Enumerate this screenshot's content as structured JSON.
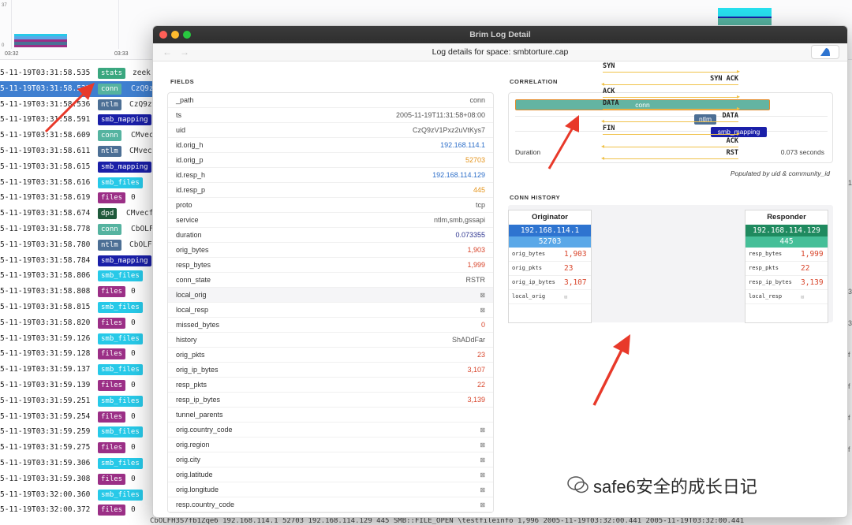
{
  "histogram": {
    "y_top": "37",
    "y_zero": "0",
    "x_labels": [
      "03:32",
      "03:33"
    ]
  },
  "log_rows": [
    {
      "ts": "5-11-19T03:31:58.535",
      "path": "stats",
      "uid": "zeek",
      "selected": false
    },
    {
      "ts": "5-11-19T03:31:58.535",
      "path": "conn",
      "uid": "CzQ9z",
      "selected": true
    },
    {
      "ts": "5-11-19T03:31:58.536",
      "path": "ntlm",
      "uid": "CzQ9z",
      "selected": false
    },
    {
      "ts": "5-11-19T03:31:58.591",
      "path": "smb_mapping",
      "uid": "",
      "selected": false
    },
    {
      "ts": "5-11-19T03:31:58.609",
      "path": "conn",
      "uid": "CMvec",
      "selected": false
    },
    {
      "ts": "5-11-19T03:31:58.611",
      "path": "ntlm",
      "uid": "CMvec",
      "selected": false
    },
    {
      "ts": "5-11-19T03:31:58.615",
      "path": "smb_mapping",
      "uid": "",
      "selected": false
    },
    {
      "ts": "5-11-19T03:31:58.616",
      "path": "smb_files",
      "uid": "",
      "selected": false
    },
    {
      "ts": "5-11-19T03:31:58.619",
      "path": "files",
      "uid": "0",
      "selected": false
    },
    {
      "ts": "5-11-19T03:31:58.674",
      "path": "dpd",
      "uid": "CMvecf",
      "selected": false
    },
    {
      "ts": "5-11-19T03:31:58.778",
      "path": "conn",
      "uid": "CbOLF",
      "selected": false
    },
    {
      "ts": "5-11-19T03:31:58.780",
      "path": "ntlm",
      "uid": "CbOLF",
      "selected": false
    },
    {
      "ts": "5-11-19T03:31:58.784",
      "path": "smb_mapping",
      "uid": "",
      "selected": false
    },
    {
      "ts": "5-11-19T03:31:58.806",
      "path": "smb_files",
      "uid": "",
      "selected": false
    },
    {
      "ts": "5-11-19T03:31:58.808",
      "path": "files",
      "uid": "0",
      "selected": false
    },
    {
      "ts": "5-11-19T03:31:58.815",
      "path": "smb_files",
      "uid": "",
      "selected": false
    },
    {
      "ts": "5-11-19T03:31:58.820",
      "path": "files",
      "uid": "0",
      "selected": false
    },
    {
      "ts": "5-11-19T03:31:59.126",
      "path": "smb_files",
      "uid": "",
      "selected": false
    },
    {
      "ts": "5-11-19T03:31:59.128",
      "path": "files",
      "uid": "0",
      "selected": false
    },
    {
      "ts": "5-11-19T03:31:59.137",
      "path": "smb_files",
      "uid": "",
      "selected": false
    },
    {
      "ts": "5-11-19T03:31:59.139",
      "path": "files",
      "uid": "0",
      "selected": false
    },
    {
      "ts": "5-11-19T03:31:59.251",
      "path": "smb_files",
      "uid": "",
      "selected": false
    },
    {
      "ts": "5-11-19T03:31:59.254",
      "path": "files",
      "uid": "0",
      "selected": false
    },
    {
      "ts": "5-11-19T03:31:59.259",
      "path": "smb_files",
      "uid": "",
      "selected": false
    },
    {
      "ts": "5-11-19T03:31:59.275",
      "path": "files",
      "uid": "0",
      "selected": false
    },
    {
      "ts": "5-11-19T03:31:59.306",
      "path": "smb_files",
      "uid": "",
      "selected": false
    },
    {
      "ts": "5-11-19T03:31:59.308",
      "path": "files",
      "uid": "0",
      "selected": false
    },
    {
      "ts": "5-11-19T03:32:00.360",
      "path": "smb_files",
      "uid": "",
      "selected": false
    },
    {
      "ts": "5-11-19T03:32:00.372",
      "path": "files",
      "uid": "0",
      "selected": false
    }
  ],
  "bottom_row_text": "CbOLFH3S7fb1Zqe6  192.168.114.1  52703  192.168.114.129  445  SMB::FILE_OPEN  \\testfileinfo  1,996  2005-11-19T03:32:00.441  2005-11-19T03:32:00.441",
  "window": {
    "title": "Brim Log Detail",
    "subtitle": "Log details for space: smbtorture.cap",
    "back_icon": "back-arrow-icon",
    "forward_icon": "forward-arrow-icon"
  },
  "fields_header": "FIELDS",
  "fields": [
    {
      "name": "_path",
      "value": "conn",
      "kind": "plain"
    },
    {
      "name": "ts",
      "value": "2005-11-19T11:31:58+08:00",
      "kind": "plain"
    },
    {
      "name": "uid",
      "value": "CzQ9zV1Pxz2uVtKys7",
      "kind": "plain"
    },
    {
      "name": "id.orig_h",
      "value": "192.168.114.1",
      "kind": "blue"
    },
    {
      "name": "id.orig_p",
      "value": "52703",
      "kind": "orange"
    },
    {
      "name": "id.resp_h",
      "value": "192.168.114.129",
      "kind": "blue"
    },
    {
      "name": "id.resp_p",
      "value": "445",
      "kind": "orange"
    },
    {
      "name": "proto",
      "value": "tcp",
      "kind": "plain"
    },
    {
      "name": "service",
      "value": "ntlm,smb,gssapi",
      "kind": "plain"
    },
    {
      "name": "duration",
      "value": "0.073355",
      "kind": "navy"
    },
    {
      "name": "orig_bytes",
      "value": "1,903",
      "kind": "red"
    },
    {
      "name": "resp_bytes",
      "value": "1,999",
      "kind": "red"
    },
    {
      "name": "conn_state",
      "value": "RSTR",
      "kind": "plain"
    },
    {
      "name": "local_orig",
      "value": "⊠",
      "kind": "null",
      "hl": true
    },
    {
      "name": "local_resp",
      "value": "⊠",
      "kind": "null"
    },
    {
      "name": "missed_bytes",
      "value": "0",
      "kind": "red"
    },
    {
      "name": "history",
      "value": "ShADdFar",
      "kind": "plain"
    },
    {
      "name": "orig_pkts",
      "value": "23",
      "kind": "red"
    },
    {
      "name": "orig_ip_bytes",
      "value": "3,107",
      "kind": "red"
    },
    {
      "name": "resp_pkts",
      "value": "22",
      "kind": "red"
    },
    {
      "name": "resp_ip_bytes",
      "value": "3,139",
      "kind": "red"
    },
    {
      "name": "tunnel_parents",
      "value": "",
      "kind": "plain"
    },
    {
      "name": "orig.country_code",
      "value": "⊠",
      "kind": "null"
    },
    {
      "name": "orig.region",
      "value": "⊠",
      "kind": "null"
    },
    {
      "name": "orig.city",
      "value": "⊠",
      "kind": "null"
    },
    {
      "name": "orig.latitude",
      "value": "⊠",
      "kind": "null"
    },
    {
      "name": "orig.longitude",
      "value": "⊠",
      "kind": "null"
    },
    {
      "name": "resp.country_code",
      "value": "⊠",
      "kind": "null"
    }
  ],
  "correlation": {
    "header": "CORRELATION",
    "conn_label": "conn",
    "ntlm_label": "ntlm",
    "smb_label": "smb_mapping",
    "duration_label": "Duration",
    "duration_value": "0.073 seconds",
    "populated_note": "Populated by uid & community_id"
  },
  "conn_history": {
    "header": "CONN HISTORY",
    "originator": {
      "title": "Originator",
      "ip": "192.168.114.1",
      "port": "52703",
      "rows": [
        {
          "k": "orig_bytes",
          "v": "1,903"
        },
        {
          "k": "orig_pkts",
          "v": "23"
        },
        {
          "k": "orig_ip_bytes",
          "v": "3,107"
        },
        {
          "k": "local_orig",
          "v": "⊠",
          "null": true
        }
      ]
    },
    "responder": {
      "title": "Responder",
      "ip": "192.168.114.129",
      "port": "445",
      "rows": [
        {
          "k": "resp_bytes",
          "v": "1,999"
        },
        {
          "k": "resp_pkts",
          "v": "22"
        },
        {
          "k": "resp_ip_bytes",
          "v": "3,139"
        },
        {
          "k": "local_resp",
          "v": "⊠",
          "null": true
        }
      ]
    },
    "flows": [
      {
        "label": "SYN",
        "dir": "right"
      },
      {
        "label": "SYN ACK",
        "dir": "left"
      },
      {
        "label": "ACK",
        "dir": "right"
      },
      {
        "label": "DATA",
        "dir": "right"
      },
      {
        "label": "DATA",
        "dir": "left"
      },
      {
        "label": "FIN",
        "dir": "right"
      },
      {
        "label": "ACK",
        "dir": "left"
      },
      {
        "label": "RST",
        "dir": "left"
      }
    ]
  },
  "watermark": "safe6安全的成长日记",
  "colors": {
    "accent_selected": "#3f7fd0",
    "annotation_arrow": "#e8392a"
  }
}
